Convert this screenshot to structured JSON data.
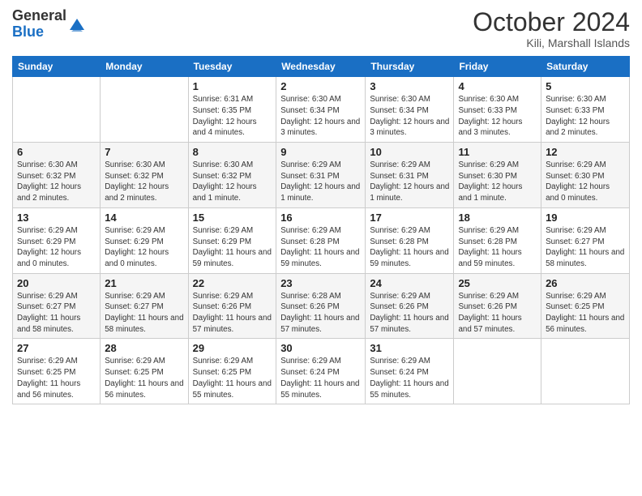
{
  "logo": {
    "general": "General",
    "blue": "Blue"
  },
  "title": "October 2024",
  "location": "Kili, Marshall Islands",
  "days_of_week": [
    "Sunday",
    "Monday",
    "Tuesday",
    "Wednesday",
    "Thursday",
    "Friday",
    "Saturday"
  ],
  "weeks": [
    [
      {
        "day": "",
        "sunrise": "",
        "sunset": "",
        "daylight": ""
      },
      {
        "day": "",
        "sunrise": "",
        "sunset": "",
        "daylight": ""
      },
      {
        "day": "1",
        "sunrise": "Sunrise: 6:31 AM",
        "sunset": "Sunset: 6:35 PM",
        "daylight": "Daylight: 12 hours and 4 minutes."
      },
      {
        "day": "2",
        "sunrise": "Sunrise: 6:30 AM",
        "sunset": "Sunset: 6:34 PM",
        "daylight": "Daylight: 12 hours and 3 minutes."
      },
      {
        "day": "3",
        "sunrise": "Sunrise: 6:30 AM",
        "sunset": "Sunset: 6:34 PM",
        "daylight": "Daylight: 12 hours and 3 minutes."
      },
      {
        "day": "4",
        "sunrise": "Sunrise: 6:30 AM",
        "sunset": "Sunset: 6:33 PM",
        "daylight": "Daylight: 12 hours and 3 minutes."
      },
      {
        "day": "5",
        "sunrise": "Sunrise: 6:30 AM",
        "sunset": "Sunset: 6:33 PM",
        "daylight": "Daylight: 12 hours and 2 minutes."
      }
    ],
    [
      {
        "day": "6",
        "sunrise": "Sunrise: 6:30 AM",
        "sunset": "Sunset: 6:32 PM",
        "daylight": "Daylight: 12 hours and 2 minutes."
      },
      {
        "day": "7",
        "sunrise": "Sunrise: 6:30 AM",
        "sunset": "Sunset: 6:32 PM",
        "daylight": "Daylight: 12 hours and 2 minutes."
      },
      {
        "day": "8",
        "sunrise": "Sunrise: 6:30 AM",
        "sunset": "Sunset: 6:32 PM",
        "daylight": "Daylight: 12 hours and 1 minute."
      },
      {
        "day": "9",
        "sunrise": "Sunrise: 6:29 AM",
        "sunset": "Sunset: 6:31 PM",
        "daylight": "Daylight: 12 hours and 1 minute."
      },
      {
        "day": "10",
        "sunrise": "Sunrise: 6:29 AM",
        "sunset": "Sunset: 6:31 PM",
        "daylight": "Daylight: 12 hours and 1 minute."
      },
      {
        "day": "11",
        "sunrise": "Sunrise: 6:29 AM",
        "sunset": "Sunset: 6:30 PM",
        "daylight": "Daylight: 12 hours and 1 minute."
      },
      {
        "day": "12",
        "sunrise": "Sunrise: 6:29 AM",
        "sunset": "Sunset: 6:30 PM",
        "daylight": "Daylight: 12 hours and 0 minutes."
      }
    ],
    [
      {
        "day": "13",
        "sunrise": "Sunrise: 6:29 AM",
        "sunset": "Sunset: 6:29 PM",
        "daylight": "Daylight: 12 hours and 0 minutes."
      },
      {
        "day": "14",
        "sunrise": "Sunrise: 6:29 AM",
        "sunset": "Sunset: 6:29 PM",
        "daylight": "Daylight: 12 hours and 0 minutes."
      },
      {
        "day": "15",
        "sunrise": "Sunrise: 6:29 AM",
        "sunset": "Sunset: 6:29 PM",
        "daylight": "Daylight: 11 hours and 59 minutes."
      },
      {
        "day": "16",
        "sunrise": "Sunrise: 6:29 AM",
        "sunset": "Sunset: 6:28 PM",
        "daylight": "Daylight: 11 hours and 59 minutes."
      },
      {
        "day": "17",
        "sunrise": "Sunrise: 6:29 AM",
        "sunset": "Sunset: 6:28 PM",
        "daylight": "Daylight: 11 hours and 59 minutes."
      },
      {
        "day": "18",
        "sunrise": "Sunrise: 6:29 AM",
        "sunset": "Sunset: 6:28 PM",
        "daylight": "Daylight: 11 hours and 59 minutes."
      },
      {
        "day": "19",
        "sunrise": "Sunrise: 6:29 AM",
        "sunset": "Sunset: 6:27 PM",
        "daylight": "Daylight: 11 hours and 58 minutes."
      }
    ],
    [
      {
        "day": "20",
        "sunrise": "Sunrise: 6:29 AM",
        "sunset": "Sunset: 6:27 PM",
        "daylight": "Daylight: 11 hours and 58 minutes."
      },
      {
        "day": "21",
        "sunrise": "Sunrise: 6:29 AM",
        "sunset": "Sunset: 6:27 PM",
        "daylight": "Daylight: 11 hours and 58 minutes."
      },
      {
        "day": "22",
        "sunrise": "Sunrise: 6:29 AM",
        "sunset": "Sunset: 6:26 PM",
        "daylight": "Daylight: 11 hours and 57 minutes."
      },
      {
        "day": "23",
        "sunrise": "Sunrise: 6:28 AM",
        "sunset": "Sunset: 6:26 PM",
        "daylight": "Daylight: 11 hours and 57 minutes."
      },
      {
        "day": "24",
        "sunrise": "Sunrise: 6:29 AM",
        "sunset": "Sunset: 6:26 PM",
        "daylight": "Daylight: 11 hours and 57 minutes."
      },
      {
        "day": "25",
        "sunrise": "Sunrise: 6:29 AM",
        "sunset": "Sunset: 6:26 PM",
        "daylight": "Daylight: 11 hours and 57 minutes."
      },
      {
        "day": "26",
        "sunrise": "Sunrise: 6:29 AM",
        "sunset": "Sunset: 6:25 PM",
        "daylight": "Daylight: 11 hours and 56 minutes."
      }
    ],
    [
      {
        "day": "27",
        "sunrise": "Sunrise: 6:29 AM",
        "sunset": "Sunset: 6:25 PM",
        "daylight": "Daylight: 11 hours and 56 minutes."
      },
      {
        "day": "28",
        "sunrise": "Sunrise: 6:29 AM",
        "sunset": "Sunset: 6:25 PM",
        "daylight": "Daylight: 11 hours and 56 minutes."
      },
      {
        "day": "29",
        "sunrise": "Sunrise: 6:29 AM",
        "sunset": "Sunset: 6:25 PM",
        "daylight": "Daylight: 11 hours and 55 minutes."
      },
      {
        "day": "30",
        "sunrise": "Sunrise: 6:29 AM",
        "sunset": "Sunset: 6:24 PM",
        "daylight": "Daylight: 11 hours and 55 minutes."
      },
      {
        "day": "31",
        "sunrise": "Sunrise: 6:29 AM",
        "sunset": "Sunset: 6:24 PM",
        "daylight": "Daylight: 11 hours and 55 minutes."
      },
      {
        "day": "",
        "sunrise": "",
        "sunset": "",
        "daylight": ""
      },
      {
        "day": "",
        "sunrise": "",
        "sunset": "",
        "daylight": ""
      }
    ]
  ]
}
